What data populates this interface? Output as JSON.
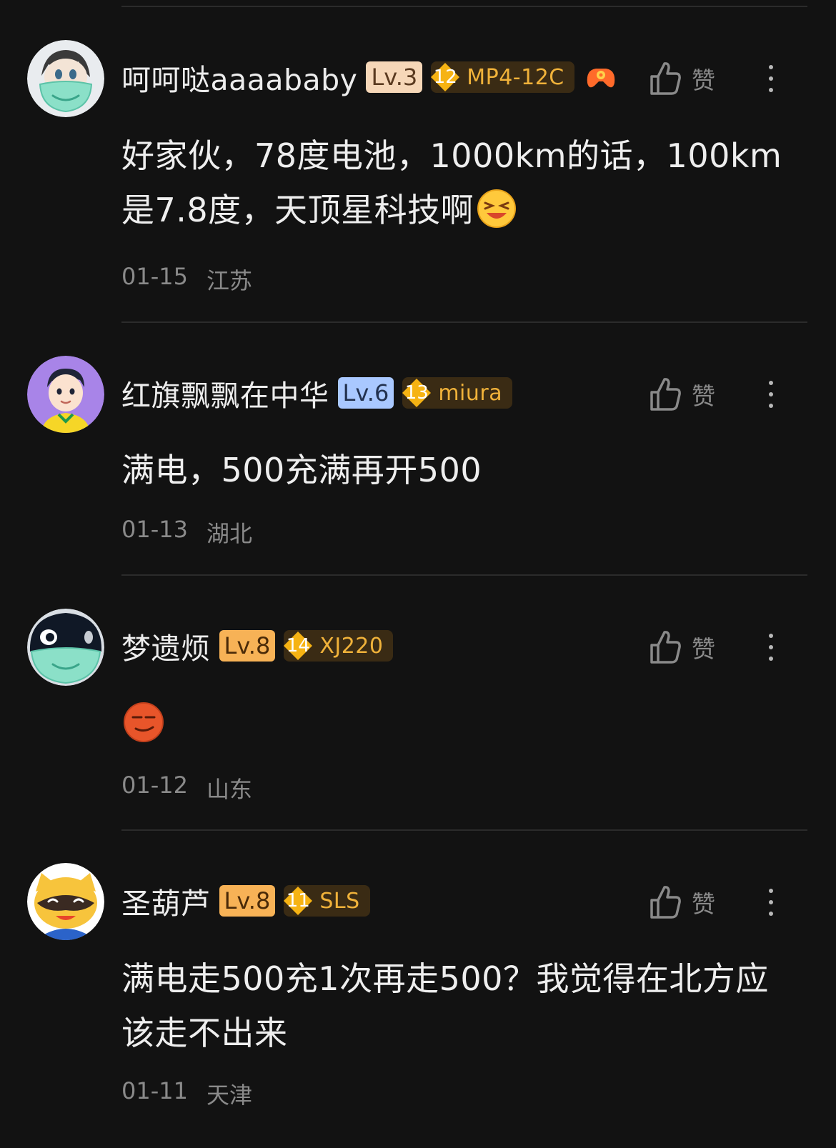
{
  "like_label": "赞",
  "comments": [
    {
      "username": "呵呵哒aaaababy",
      "level": "Lv.3",
      "fan_level": "12",
      "fan_name": "MP4-12C",
      "text": "好家伙，78度电池，1000km的话，100km是7.8度，天顶星科技啊",
      "date": "01-15",
      "location": "江苏",
      "avatar_icon": "masked-anime-avatar-icon",
      "extra_badge_icon": "game-controller-badge-icon"
    },
    {
      "username": "红旗飘飘在中华",
      "level": "Lv.6",
      "fan_level": "13",
      "fan_name": "miura",
      "text": "满电，500充满再开500",
      "date": "01-13",
      "location": "湖北"
    },
    {
      "username": "梦遗烦",
      "level": "Lv.8",
      "fan_level": "14",
      "fan_name": "XJ220",
      "text": "",
      "date": "01-12",
      "location": "山东"
    },
    {
      "username": "圣葫芦",
      "level": "Lv.8",
      "fan_level": "11",
      "fan_name": "SLS",
      "text": "满电走500充1次再走500？我觉得在北方应该走不出来",
      "date": "01-11",
      "location": "天津"
    }
  ],
  "colors": {
    "background": "#121212",
    "fan_name": "#f0b23a",
    "lv3": "#f6d7b8",
    "lv6": "#a9c8ff",
    "lv8": "#f7b256"
  }
}
